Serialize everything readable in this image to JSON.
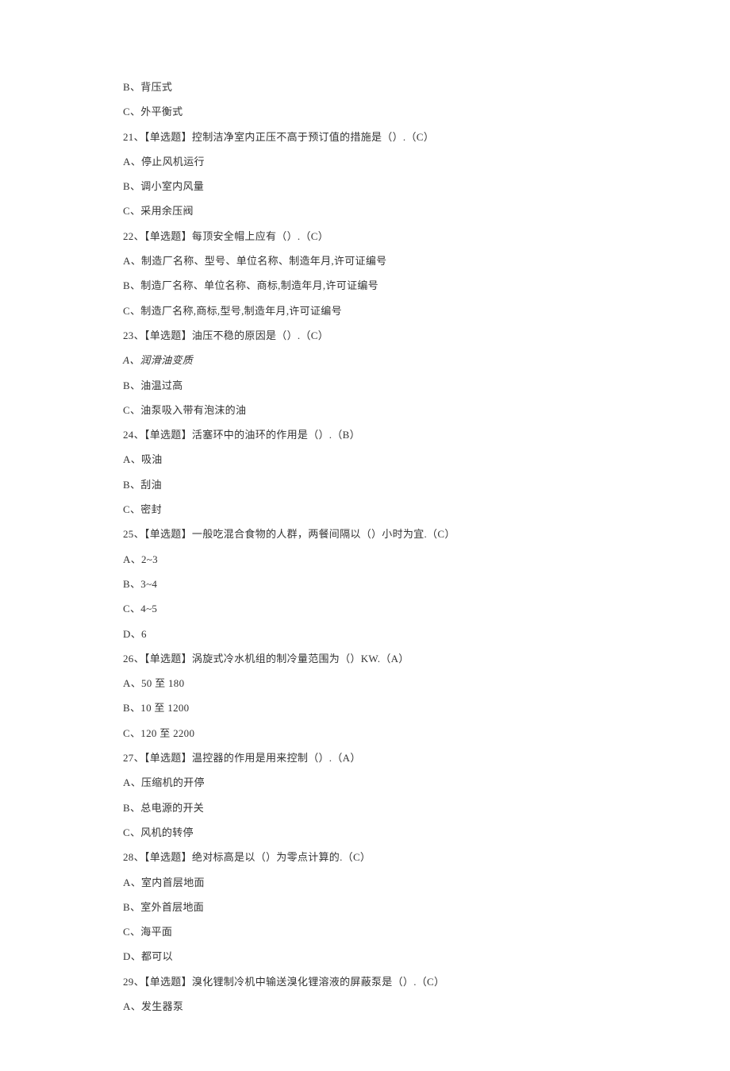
{
  "lines": [
    {
      "text": "B、背压式"
    },
    {
      "text": "C、外平衡式"
    },
    {
      "text": "21、【单选题】控制洁净室内正压不高于预订值的措施是（）.（C）"
    },
    {
      "text": "A、停止风机运行"
    },
    {
      "text": "B、调小室内风量"
    },
    {
      "text": "C、采用余压阀"
    },
    {
      "text": "22、【单选题】每顶安全帽上应有（）.（C）"
    },
    {
      "text": "A、制造厂名称、型号、单位名称、制造年月,许可证编号"
    },
    {
      "text": "B、制造厂名称、单位名称、商标,制造年月,许可证编号"
    },
    {
      "text": "C、制造厂名称,商标,型号,制造年月,许可证编号"
    },
    {
      "text": "23、【单选题】油压不稳的原因是（）.（C）"
    },
    {
      "text": "A、润滑油变质",
      "italic": true
    },
    {
      "text": "B、油温过高"
    },
    {
      "text": "C、油泵吸入带有泡沫的油"
    },
    {
      "text": "24、【单选题】活塞环中的油环的作用是（）.（B）"
    },
    {
      "text": "A、吸油"
    },
    {
      "text": "B、刮油"
    },
    {
      "text": "C、密封"
    },
    {
      "text": "25、【单选题】一般吃混合食物的人群，两餐间隔以（）小时为宜.（C）"
    },
    {
      "text": "A、2~3"
    },
    {
      "text": "B、3~4"
    },
    {
      "text": "C、4~5"
    },
    {
      "text": "D、6"
    },
    {
      "text": "26、【单选题】涡旋式冷水机组的制冷量范围为（）KW.（A）"
    },
    {
      "text": "A、50 至 180"
    },
    {
      "text": "B、10 至 1200"
    },
    {
      "text": "C、120 至 2200"
    },
    {
      "text": "27、【单选题】温控器的作用是用来控制（）.（A）"
    },
    {
      "text": "A、压缩机的开停"
    },
    {
      "text": "B、总电源的开关"
    },
    {
      "text": "C、风机的转停"
    },
    {
      "text": "28、【单选题】绝对标高是以（）为零点计算的.（C）"
    },
    {
      "text": "A、室内首层地面"
    },
    {
      "text": "B、室外首层地面"
    },
    {
      "text": "C、海平面"
    },
    {
      "text": "D、都可以"
    },
    {
      "text": "29、【单选题】溴化锂制冷机中输送溴化锂溶液的屏蔽泵是（）.（C）"
    },
    {
      "text": "A、发生器泵"
    }
  ]
}
